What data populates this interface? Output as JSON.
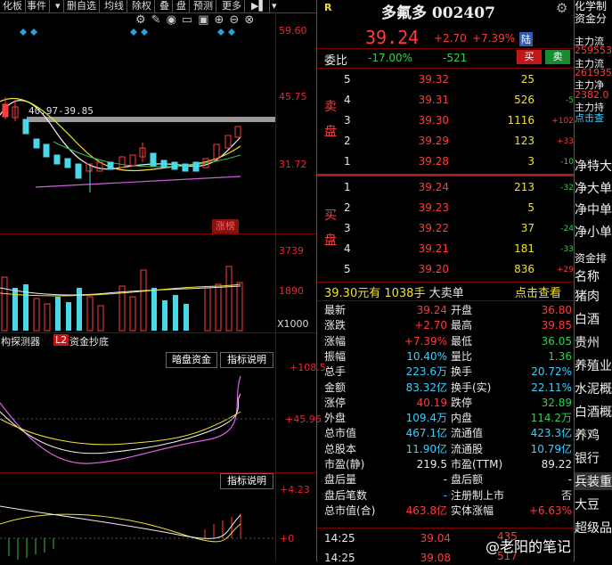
{
  "toolbar": {
    "items": [
      "化板",
      "事件",
      "删自选",
      "均线",
      "除权",
      "叠",
      "盘",
      "预测",
      "更多"
    ]
  },
  "chart": {
    "y_top": "59.60",
    "y_mid": "45.75",
    "y_low": "31.72",
    "range_label": "40.97-39.85",
    "tag": "涨榜",
    "vol_top": "3739",
    "vol_mid": "1890",
    "vol_unit": "X1000",
    "indicator_tabs": [
      "构探测器",
      "L2",
      "资金抄底"
    ],
    "sub1_buttons": [
      "暗盘资金",
      "指标说明"
    ],
    "sub1_top": "+108.5",
    "sub1_mid": "+45.96",
    "sub2_button": "指标说明",
    "sub2_top": "+4.23",
    "sub2_mid": "+0"
  },
  "quote": {
    "flag": "R",
    "name": "多氟多",
    "code": "002407",
    "price": "39.24",
    "change": "+2.70",
    "pct": "+7.39%",
    "board": "陆",
    "webi_label": "委比",
    "webi_pct": "-17.00%",
    "webi_val": "-521",
    "buy_btn": "买",
    "sell_btn": "卖",
    "sell_label": [
      "卖",
      "盘"
    ],
    "buy_label": [
      "买",
      "盘"
    ],
    "asks": [
      {
        "lvl": "5",
        "price": "39.32",
        "vol": "25",
        "chg": ""
      },
      {
        "lvl": "4",
        "price": "39.31",
        "vol": "526",
        "chg": "-5"
      },
      {
        "lvl": "3",
        "price": "39.30",
        "vol": "1116",
        "chg": "+102"
      },
      {
        "lvl": "2",
        "price": "39.29",
        "vol": "123",
        "chg": "+33"
      },
      {
        "lvl": "1",
        "price": "39.28",
        "vol": "3",
        "chg": "-10"
      }
    ],
    "bids": [
      {
        "lvl": "1",
        "price": "39.24",
        "vol": "213",
        "chg": "-32"
      },
      {
        "lvl": "2",
        "price": "39.23",
        "vol": "5",
        "chg": ""
      },
      {
        "lvl": "3",
        "price": "39.22",
        "vol": "37",
        "chg": "-24"
      },
      {
        "lvl": "4",
        "price": "39.21",
        "vol": "181",
        "chg": "-33"
      },
      {
        "lvl": "5",
        "price": "39.20",
        "vol": "836",
        "chg": "+29"
      }
    ],
    "big_order": {
      "price": "39.30元有",
      "vol": "1038手",
      "label": "大卖单",
      "link": "点击查看"
    },
    "stats": [
      [
        "最新",
        "39.24",
        "开盘",
        "36.80"
      ],
      [
        "涨跌",
        "+2.70",
        "最高",
        "39.85"
      ],
      [
        "涨幅",
        "+7.39%",
        "最低",
        "36.05"
      ],
      [
        "振幅",
        "10.40%",
        "量比",
        "1.36"
      ],
      [
        "总手",
        "223.6万",
        "换手",
        "20.72%"
      ],
      [
        "金额",
        "83.32亿",
        "换手(实)",
        "22.11%"
      ],
      [
        "涨停",
        "40.19",
        "跌停",
        "32.89"
      ],
      [
        "外盘",
        "109.4万",
        "内盘",
        "114.2万"
      ],
      [
        "总市值",
        "467.1亿",
        "流通值",
        "423.3亿"
      ],
      [
        "总股本",
        "11.90亿",
        "流通股",
        "10.79亿"
      ],
      [
        "市盈(静)",
        "219.5",
        "市盈(TTM)",
        "89.22"
      ],
      [
        "盘后量",
        "-",
        "盘后额",
        "-"
      ],
      [
        "盘后笔数",
        "-",
        "注册制上市",
        "否"
      ],
      [
        "总市值(合)",
        "463.8亿",
        "实体涨幅",
        "+6.63%"
      ]
    ],
    "ticks": [
      {
        "time": "14:25",
        "price": "39.04",
        "vol": "435"
      },
      {
        "time": "14:25",
        "price": "39.08",
        "vol": "517"
      }
    ],
    "watermark": "@老阳的笔记"
  },
  "right": {
    "top": [
      "化学制",
      "资金分"
    ],
    "flow": [
      "主力流",
      "259553",
      "主力流",
      "261935",
      "主力净",
      "2382.0",
      "主力持",
      "点击查"
    ],
    "cats": [
      "净特大",
      "净大单",
      "净中单",
      "净小单"
    ],
    "head": "资金排",
    "col": "名称",
    "list": [
      "猪肉",
      "白酒",
      "贵州",
      "养殖业",
      "水泥概",
      "白酒概",
      "养鸡",
      "银行",
      "兵装重",
      "大豆",
      "超级品"
    ]
  }
}
